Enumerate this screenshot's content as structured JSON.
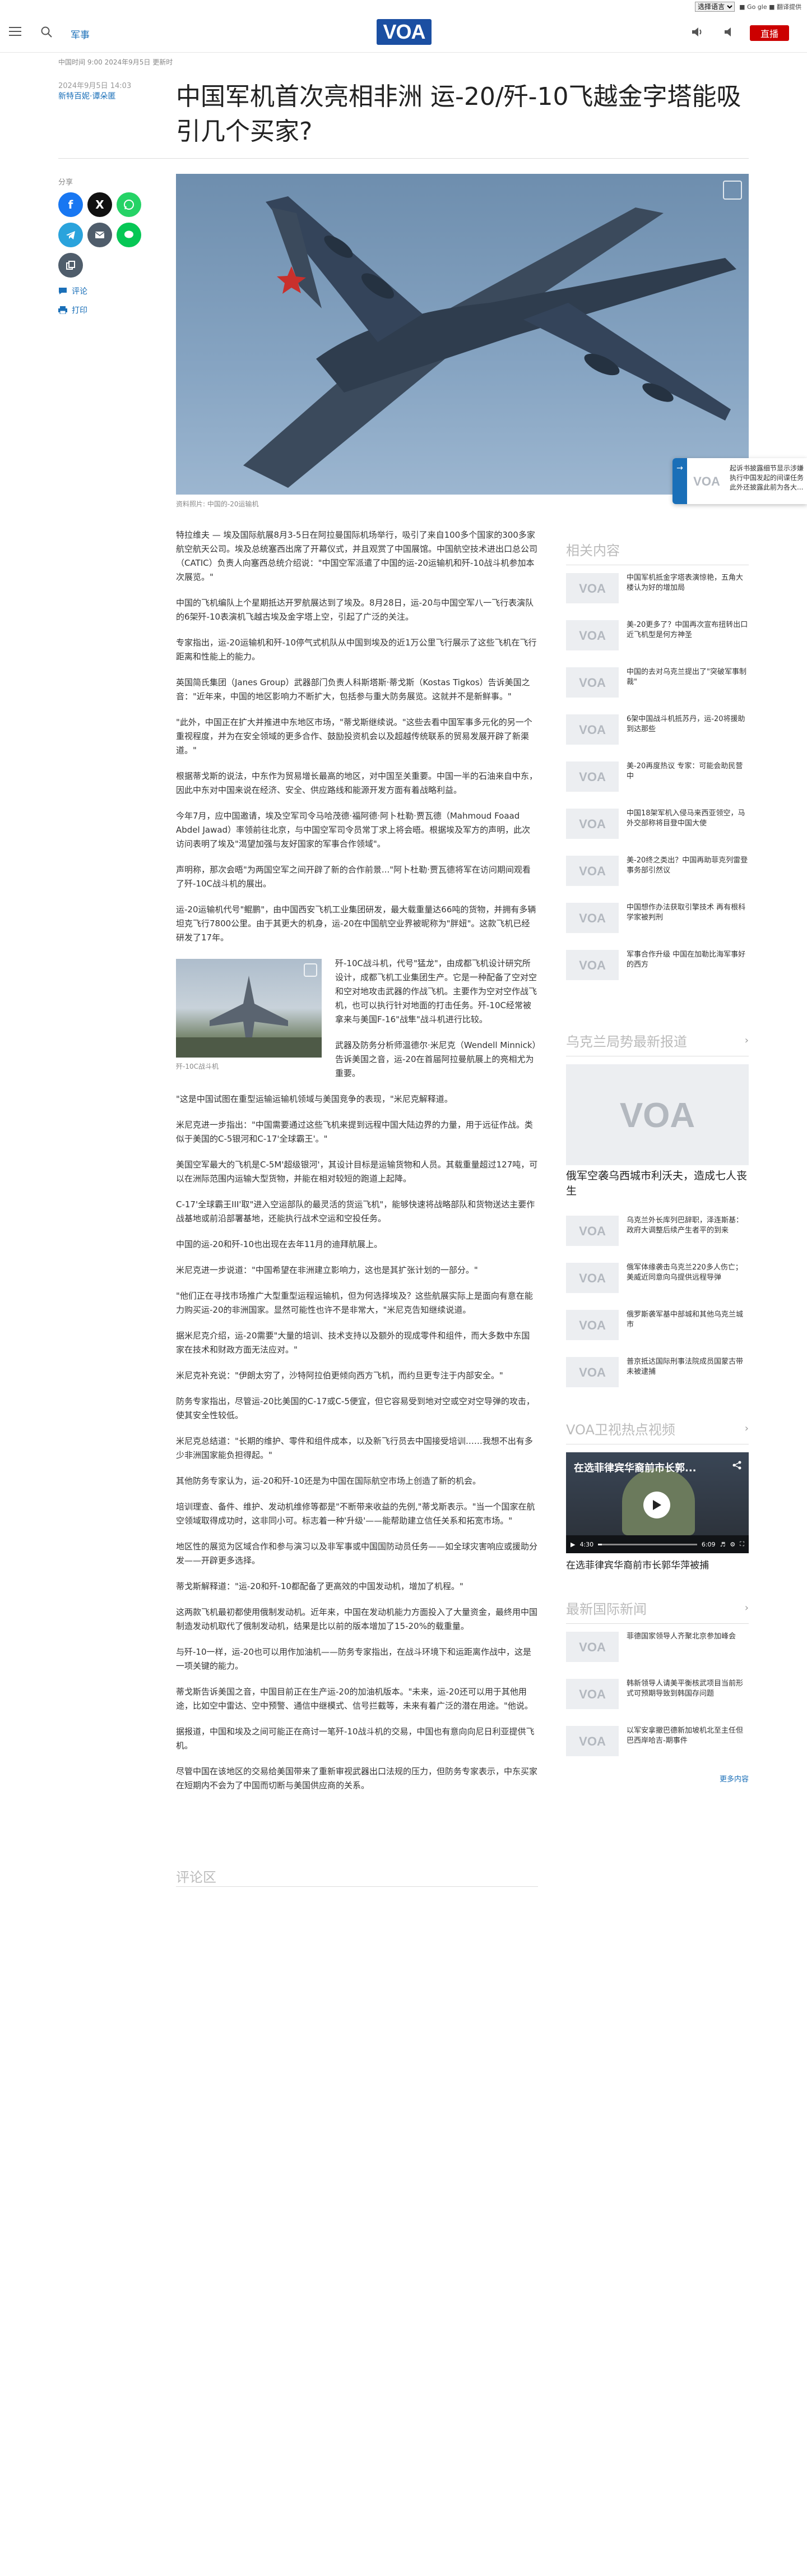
{
  "util": {
    "lang_select": "选择语言",
    "right_text": "■ Go gle ■ 翻译提供"
  },
  "header": {
    "section": "军事",
    "logo_text": "VOA",
    "live_label": "直播"
  },
  "dateline": "中国时间 9:00 2024年9月5日 更新时",
  "meta": {
    "date": "2024年9月5日 14:03",
    "author": "新特百妮·谭朵匿"
  },
  "headline": "中国军机首次亮相非洲 运-20/歼-10飞越金字塔能吸引几个买家?",
  "share": {
    "label": "分享",
    "comments": "评论",
    "print": "打印"
  },
  "hero": {
    "caption": "资料照片: 中国的-20运输机"
  },
  "float_widget": {
    "text": "起诉书披露细节显示涉嫌执行中国发起的间谍任务此外还披露此前为各大..."
  },
  "article": {
    "p1": "特拉维夫 — 埃及国际航展8月3-5日在阿拉曼国际机场举行，吸引了来自100多个国家的300多家航空航天公司。埃及总统塞西出席了开幕仪式，并且观赏了中国展馆。中国航空技术进出口总公司（CATIC）负责人向塞西总统介绍说：\"中国空军派遣了中国的运-20运输机和歼-10战斗机参加本次展览。\"",
    "p2": "中国的飞机编队上个星期抵达开罗航展达到了埃及。8月28日，运-20与中国空军八一飞行表演队的6架歼-10表演机飞越古埃及金字塔上空，引起了广泛的关注。",
    "p3": "专家指出，运-20运输机和歼-10停气式机队从中国到埃及的近1万公里飞行展示了这些飞机在飞行距离和性能上的能力。",
    "p4": "英国简氏集团（Janes Group）武器部门负责人科斯塔斯·蒂戈斯（Kostas Tigkos）告诉美国之音：\"近年来，中国的地区影响力不断扩大，包括参与重大防务展览。这就并不是新鲜事。\"",
    "p5": "\"此外，中国正在扩大并推进中东地区市场，\"蒂戈斯继续说。\"这些去看中国军事多元化的另一个重视程度，并为在安全领域的更多合作、鼓励投资机会以及超越传统联系的贸易发展开辟了新渠道。\"",
    "p6": "根据蒂戈斯的说法，中东作为贸易增长最高的地区，对中国至关重要。中国一半的石油来自中东，因此中东对中国来说在经济、安全、供应路线和能源开发方面有着战略利益。",
    "p7": "今年7月，应中国邀请，埃及空军司令马哈茂德·福阿德·阿卜杜勒·贾瓦德（Mahmoud Foaad Abdel Jawad）率领前往北京，与中国空军司令员常丁求上将会晤。根据埃及军方的声明，此次访问表明了埃及\"渴望加强与友好国家的军事合作领域\"。",
    "p8": "声明称，那次会晤\"为两国空军之间开辟了新的合作前景...\"阿卜杜勒·贾瓦德将军在访问期间观看了歼-10C战斗机的展出。",
    "p9": "运-20运输机代号\"鲲鹏\"，由中国西安飞机工业集团研发，最大载重量达66吨的货物，并拥有多辆坦克飞行7800公里。由于其更大的机身，运-20在中国航空业界被昵称为\"胖妞\"。这款飞机已经研发了17年。",
    "p10": "歼-10C战斗机，代号\"猛龙\"，由成都飞机设计研究所设计，成都飞机工业集团生产。它是一种配备了空对空和空对地攻击武器的作战飞机。主要作为空对空作战飞机，也可以执行针对地面的打击任务。歼-10C经常被拿来与美国F-16\"战隼\"战斗机进行比较。",
    "p11": "武器及防务分析师温德尔·米尼克（Wendell Minnick）告诉美国之音，运-20在首届阿拉曼航展上的亮相尤为重要。",
    "p12": "\"这是中国试图在重型运输运输机领域与美国竞争的表现，\"米尼克解释道。",
    "p13": "米尼克进一步指出：\"中国需要通过这些飞机来提到远程中国大陆边界的力量，用于远征作战。类似于美国的C-5银河和C-17'全球霸王'。\"",
    "p14": "美国空军最大的飞机是C-5M'超级银河'，其设计目标是运输货物和人员。其载重量超过127吨，可以在洲际范围内运输大型货物，并能在相对较短的跑道上起降。",
    "p15": "C-17'全球霸王III'取\"进入空运部队的最灵活的货运飞机\"，能够快速将战略部队和货物送达主要作战基地或前沿部署基地，还能执行战术空运和空投任务。",
    "p16": "中国的运-20和歼-10也出现在去年11月的迪拜航展上。",
    "p17": "米尼克进一步说道：\"中国希望在非洲建立影响力，这也是其扩张计划的一部分。\"",
    "p18": "\"他们正在寻找市场推广大型重型运程运输机，但为何选择埃及？这些航展实际上是面向有意在能力购买运-20的非洲国家。显然可能性也许不是非常大，\"米尼克告知继续说道。",
    "p19": "据米尼克介绍，运-20需要\"大量的培训、技术支持以及额外的现成零件和组件，而大多数中东国家在技术和财政方面无法应对。\"",
    "p20": "米尼克补充说：\"伊朗太穷了，沙特阿拉伯更倾向西方飞机，而约旦更专注于内部安全。\"",
    "p21": "防务专家指出，尽管运-20比美国的C-17或C-5便宜，但它容易受到地对空或空对空导弹的攻击，使其安全性较低。",
    "p22": "米尼克总结道：\"长期的维护、零件和组件成本，以及新飞行员去中国接受培训……我想不出有多少非洲国家能负担得起。\"",
    "p23": "其他防务专家认为，运-20和歼-10还是为中国在国际航空市场上创造了新的机会。",
    "p24": "培训理查、备件、维护、发动机维修等都是\"不断带来收益的先例,\"蒂戈斯表示。\"当一个国家在航空领域取得成功时，这非同小可。标志着一种'升级'——能帮助建立信任关系和拓宽市场。\"",
    "p25": "地区性的展览为区域合作和参与演习以及非军事或中国国防动员任务——如全球灾害响应或援助分发——开辟更多选择。",
    "p26": "蒂戈斯解释道：\"运-20和歼-10都配备了更高效的中国发动机，增加了机程。\"",
    "p27": "这两款飞机最初都使用俄制发动机。近年来，中国在发动机能力方面投入了大量资金，最终用中国制造发动机取代了俄制发动机，结果是比以前的版本增加了15-20%的载重量。",
    "p28": "与歼-10一样，运-20也可以用作加油机——防务专家指出，在战斗环境下和运距离作战中，这是一项关键的能力。",
    "p29": "蒂戈斯告诉美国之音，中国目前正在生产运-20的加油机版本。\"未来，运-20还可以用于其他用途，比如空中雷达、空中预警、通信中继模式、信号拦截等，未来有着广泛的潜在用途。\"他说。",
    "p30": "据报道，中国和埃及之间可能正在商讨一笔歼-10战斗机的交易，中国也有意向向尼日利亚提供飞机。",
    "p31": "尽管中国在该地区的交易给美国带来了重新审视武器出口法规的压力，但防务专家表示，中东买家在短期内不会为了中国而切断与美国供应商的关系。",
    "inline_caption": "歼-10C战斗机"
  },
  "comments_title": "评论区",
  "rail": {
    "related_title": "相关内容",
    "related": [
      "中国军机抵金字塔表演惊艳，五角大楼认为好的增加局",
      "美-20更多了？中国再次宣布扭转出口近飞机型是何方神圣",
      "中国的去对乌克兰提出了\"突破军事制裁\"",
      "6架中国战斗机抵苏丹，运-20将援助到达那些",
      "美-20再度热议 专家：可能会助民营中",
      "中国18架军机入侵马来西亚领空，马外交部称将目登中国大使",
      "美-20终之类出？中国再助菲克列雷登事务部引然议",
      "中国想作办法获取引擎技术 再有根科学家被判刑",
      "军事合作升级 中国在加勒比海军事好的西方"
    ],
    "ukraine_title": "乌克兰局势最新报道",
    "ukraine_big": "俄军空袭乌西城市利沃夫，造成七人丧生",
    "ukraine": [
      "乌克兰外长库列巴辞职，泽连斯基：政府大调整后续产生者平的到来",
      "俄军体缘袭击乌克兰220多人伤亡；美威近同意向乌提供远程导弹",
      "俄罗斯袭军基中部城和其他乌克兰城市",
      "普京抵达国际刑事法院成员国蒙古带未被逮捕"
    ],
    "video_title": "VOA卫视热点视频",
    "video_overlay": "在选菲律宾华裔前市长郭...",
    "video_time_a": "4:30",
    "video_time_b": "6:09",
    "video_caption": "在选菲律宾华裔前市长郭华萍被捕",
    "intl_title": "最新国际新闻",
    "intl": [
      "菲德国家领导人齐聚北京参加峰会",
      "韩新领导人请美平衡核武项目当前形式可预期导致到韩国存问题",
      "以军安拿撤巴德新加坡机北至主任但巴西岸哈吉-期事件"
    ],
    "more": "更多内容"
  },
  "colors": {
    "accent": "#1a6fb8",
    "live": "#cc0000",
    "logo": "#1b4fa2"
  }
}
